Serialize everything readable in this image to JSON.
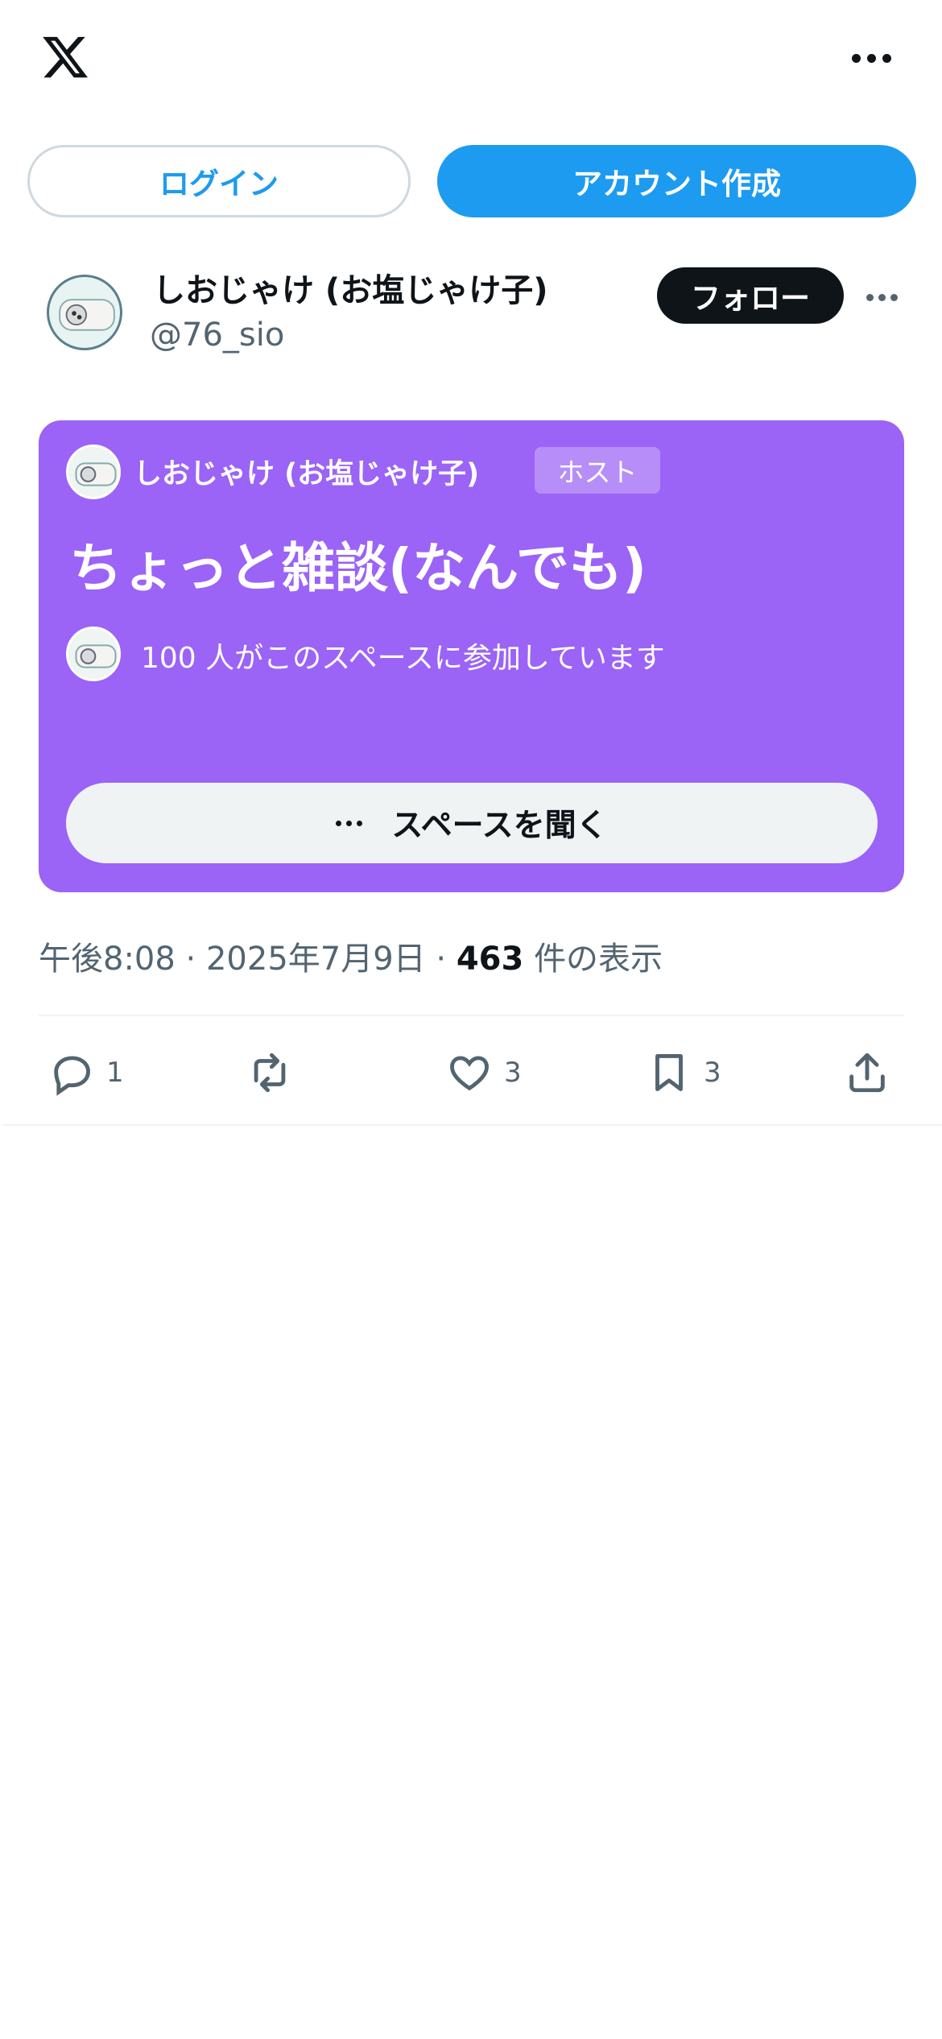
{
  "topbar": {
    "logo_icon": "x-logo-icon",
    "more_icon": "more-horizontal-icon"
  },
  "auth": {
    "login_label": "ログイン",
    "signup_label": "アカウント作成"
  },
  "author": {
    "display_name": "しおじゃけ (お塩じゃけ子)",
    "handle": "@76_sio",
    "follow_label": "フォロー"
  },
  "space": {
    "host_name": "しおじゃけ (お塩じゃけ子)",
    "host_badge": "ホスト",
    "title": "ちょっと雑談(なんでも)",
    "participants_text": "100 人がこのスペースに参加しています",
    "listen_label": "スペースを聞く",
    "card_color": "#9b63f6"
  },
  "meta": {
    "time": "午後8:08",
    "separator": "·",
    "date": "2025年7月9日",
    "views_count": "463",
    "views_label": "件の表示"
  },
  "actions": {
    "reply_count": "1",
    "repost_count": "",
    "like_count": "3",
    "bookmark_count": "3"
  },
  "colors": {
    "accent": "#1d9bf0",
    "text": "#0f1419",
    "secondary": "#536471"
  }
}
